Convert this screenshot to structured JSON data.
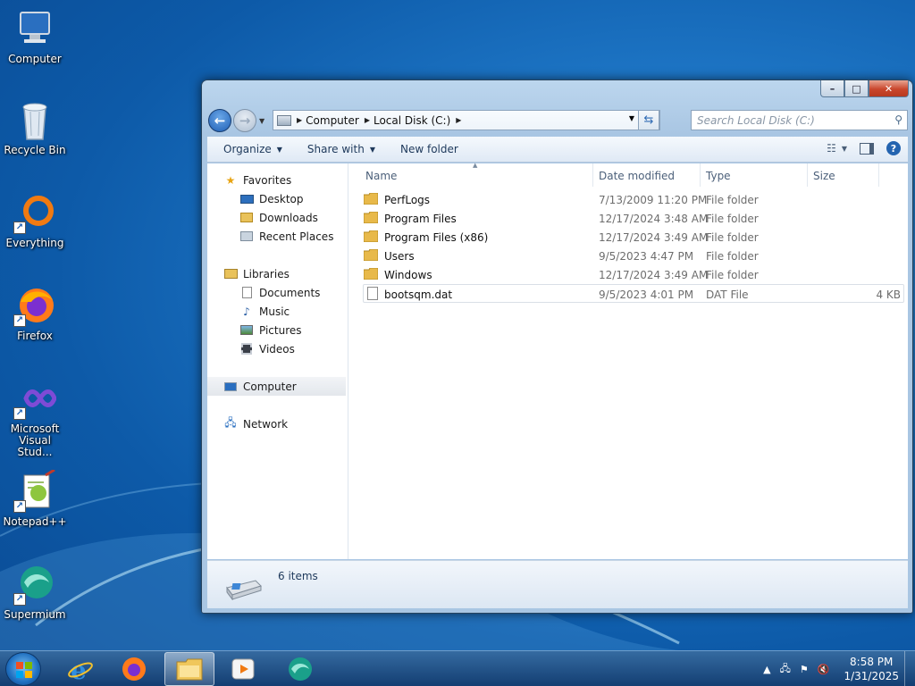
{
  "desktop": {
    "icons": [
      {
        "label": "Computer"
      },
      {
        "label": "Recycle Bin"
      },
      {
        "label": "Everything"
      },
      {
        "label": "Firefox"
      },
      {
        "label": "Microsoft Visual Stud..."
      },
      {
        "label": "Notepad++"
      },
      {
        "label": "Supermium"
      }
    ]
  },
  "window": {
    "controls": {
      "minimize": "–",
      "maximize": "□",
      "close": "✕"
    },
    "address": {
      "crumbs": [
        "Computer",
        "Local Disk (C:)"
      ]
    },
    "search": {
      "placeholder": "Search Local Disk (C:)"
    },
    "toolbar": {
      "organize": "Organize",
      "share_with": "Share with",
      "new_folder": "New folder"
    },
    "navpane": {
      "favorites": {
        "label": "Favorites",
        "items": [
          "Desktop",
          "Downloads",
          "Recent Places"
        ]
      },
      "libraries": {
        "label": "Libraries",
        "items": [
          "Documents",
          "Music",
          "Pictures",
          "Videos"
        ]
      },
      "computer": "Computer",
      "network": "Network"
    },
    "columns": {
      "name": "Name",
      "date": "Date modified",
      "type": "Type",
      "size": "Size"
    },
    "files": [
      {
        "name": "PerfLogs",
        "date": "7/13/2009 11:20 PM",
        "type": "File folder",
        "size": ""
      },
      {
        "name": "Program Files",
        "date": "12/17/2024 3:48 AM",
        "type": "File folder",
        "size": ""
      },
      {
        "name": "Program Files (x86)",
        "date": "12/17/2024 3:49 AM",
        "type": "File folder",
        "size": ""
      },
      {
        "name": "Users",
        "date": "9/5/2023 4:47 PM",
        "type": "File folder",
        "size": ""
      },
      {
        "name": "Windows",
        "date": "12/17/2024 3:49 AM",
        "type": "File folder",
        "size": ""
      },
      {
        "name": "bootsqm.dat",
        "date": "9/5/2023 4:01 PM",
        "type": "DAT File",
        "size": "4 KB"
      }
    ],
    "status": {
      "count": "6 items"
    }
  },
  "taskbar": {
    "clock": {
      "time": "8:58 PM",
      "date": "1/31/2025"
    },
    "tray_expand": "▲"
  }
}
